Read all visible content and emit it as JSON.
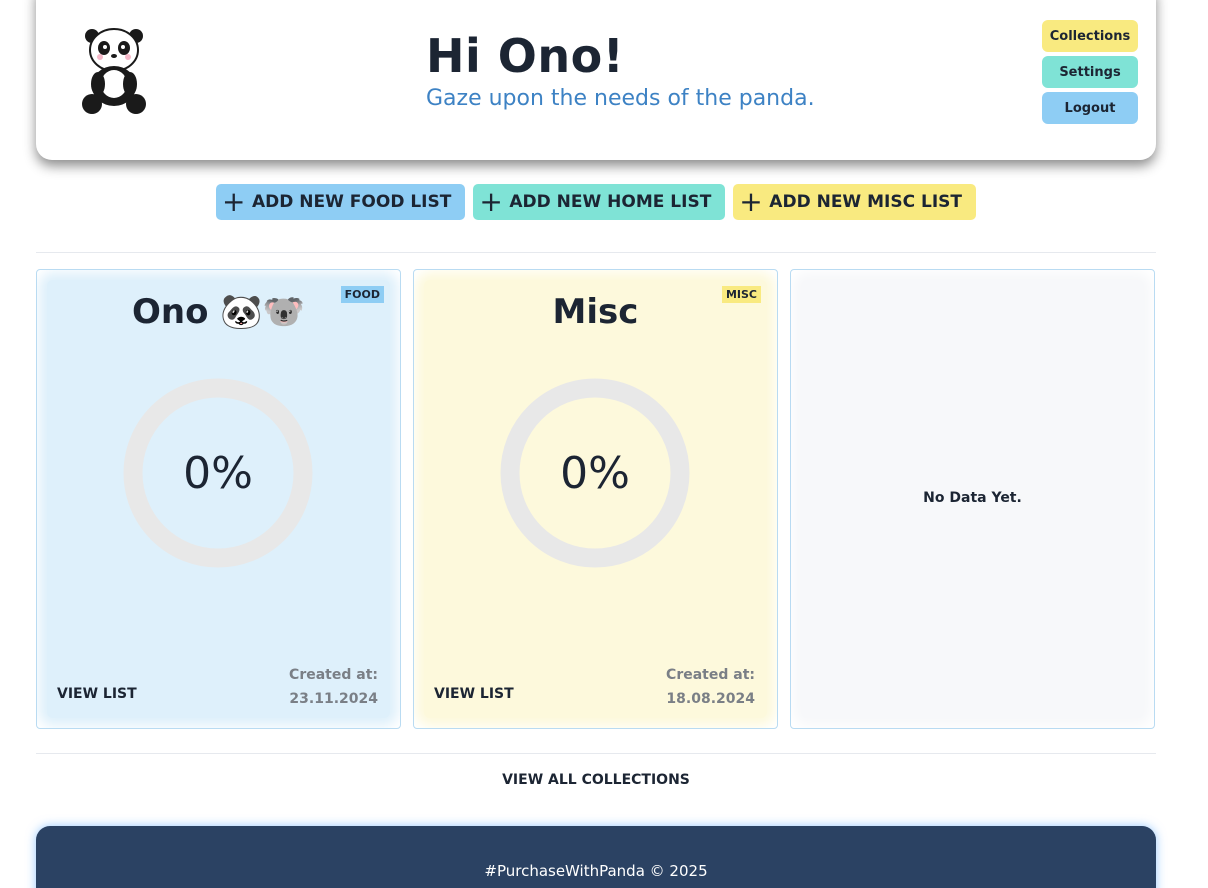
{
  "header": {
    "greeting": "Hi Ono!",
    "subtitle": "Gaze upon the needs of the panda.",
    "logo_icon": "panda-logo-icon",
    "nav": [
      {
        "label": "Collections",
        "color": "#f9ea80"
      },
      {
        "label": "Settings",
        "color": "#7fe3d6"
      },
      {
        "label": "Logout",
        "color": "#8ecdf4"
      }
    ]
  },
  "add_buttons": [
    {
      "label": "ADD NEW FOOD LIST",
      "icon": "plus-icon",
      "color": "#8ecdf4"
    },
    {
      "label": "ADD NEW HOME LIST",
      "icon": "plus-icon",
      "color": "#7fe3d6"
    },
    {
      "label": "ADD NEW MISC LIST",
      "icon": "plus-icon",
      "color": "#f9ea80"
    }
  ],
  "cards": [
    {
      "tag": "FOOD",
      "tag_color": "#8ecdf4",
      "bg_color": "#def0fb",
      "title": "Ono 🐼🐨",
      "progress_label": "0%",
      "progress": 0,
      "view_label": "VIEW LIST",
      "created_label": "Created at:",
      "created_date": "23.11.2024"
    },
    {
      "tag": "MISC",
      "tag_color": "#f9ea80",
      "bg_color": "#fdf9dc",
      "title": "Misc",
      "progress_label": "0%",
      "progress": 0,
      "view_label": "VIEW LIST",
      "created_label": "Created at:",
      "created_date": "18.08.2024"
    }
  ],
  "empty_card": {
    "message": "No Data Yet.",
    "bg_color": "#f7f8fa"
  },
  "view_all_label": "VIEW ALL COLLECTIONS",
  "footer": {
    "text": "#PurchaseWithPanda © 2025"
  }
}
